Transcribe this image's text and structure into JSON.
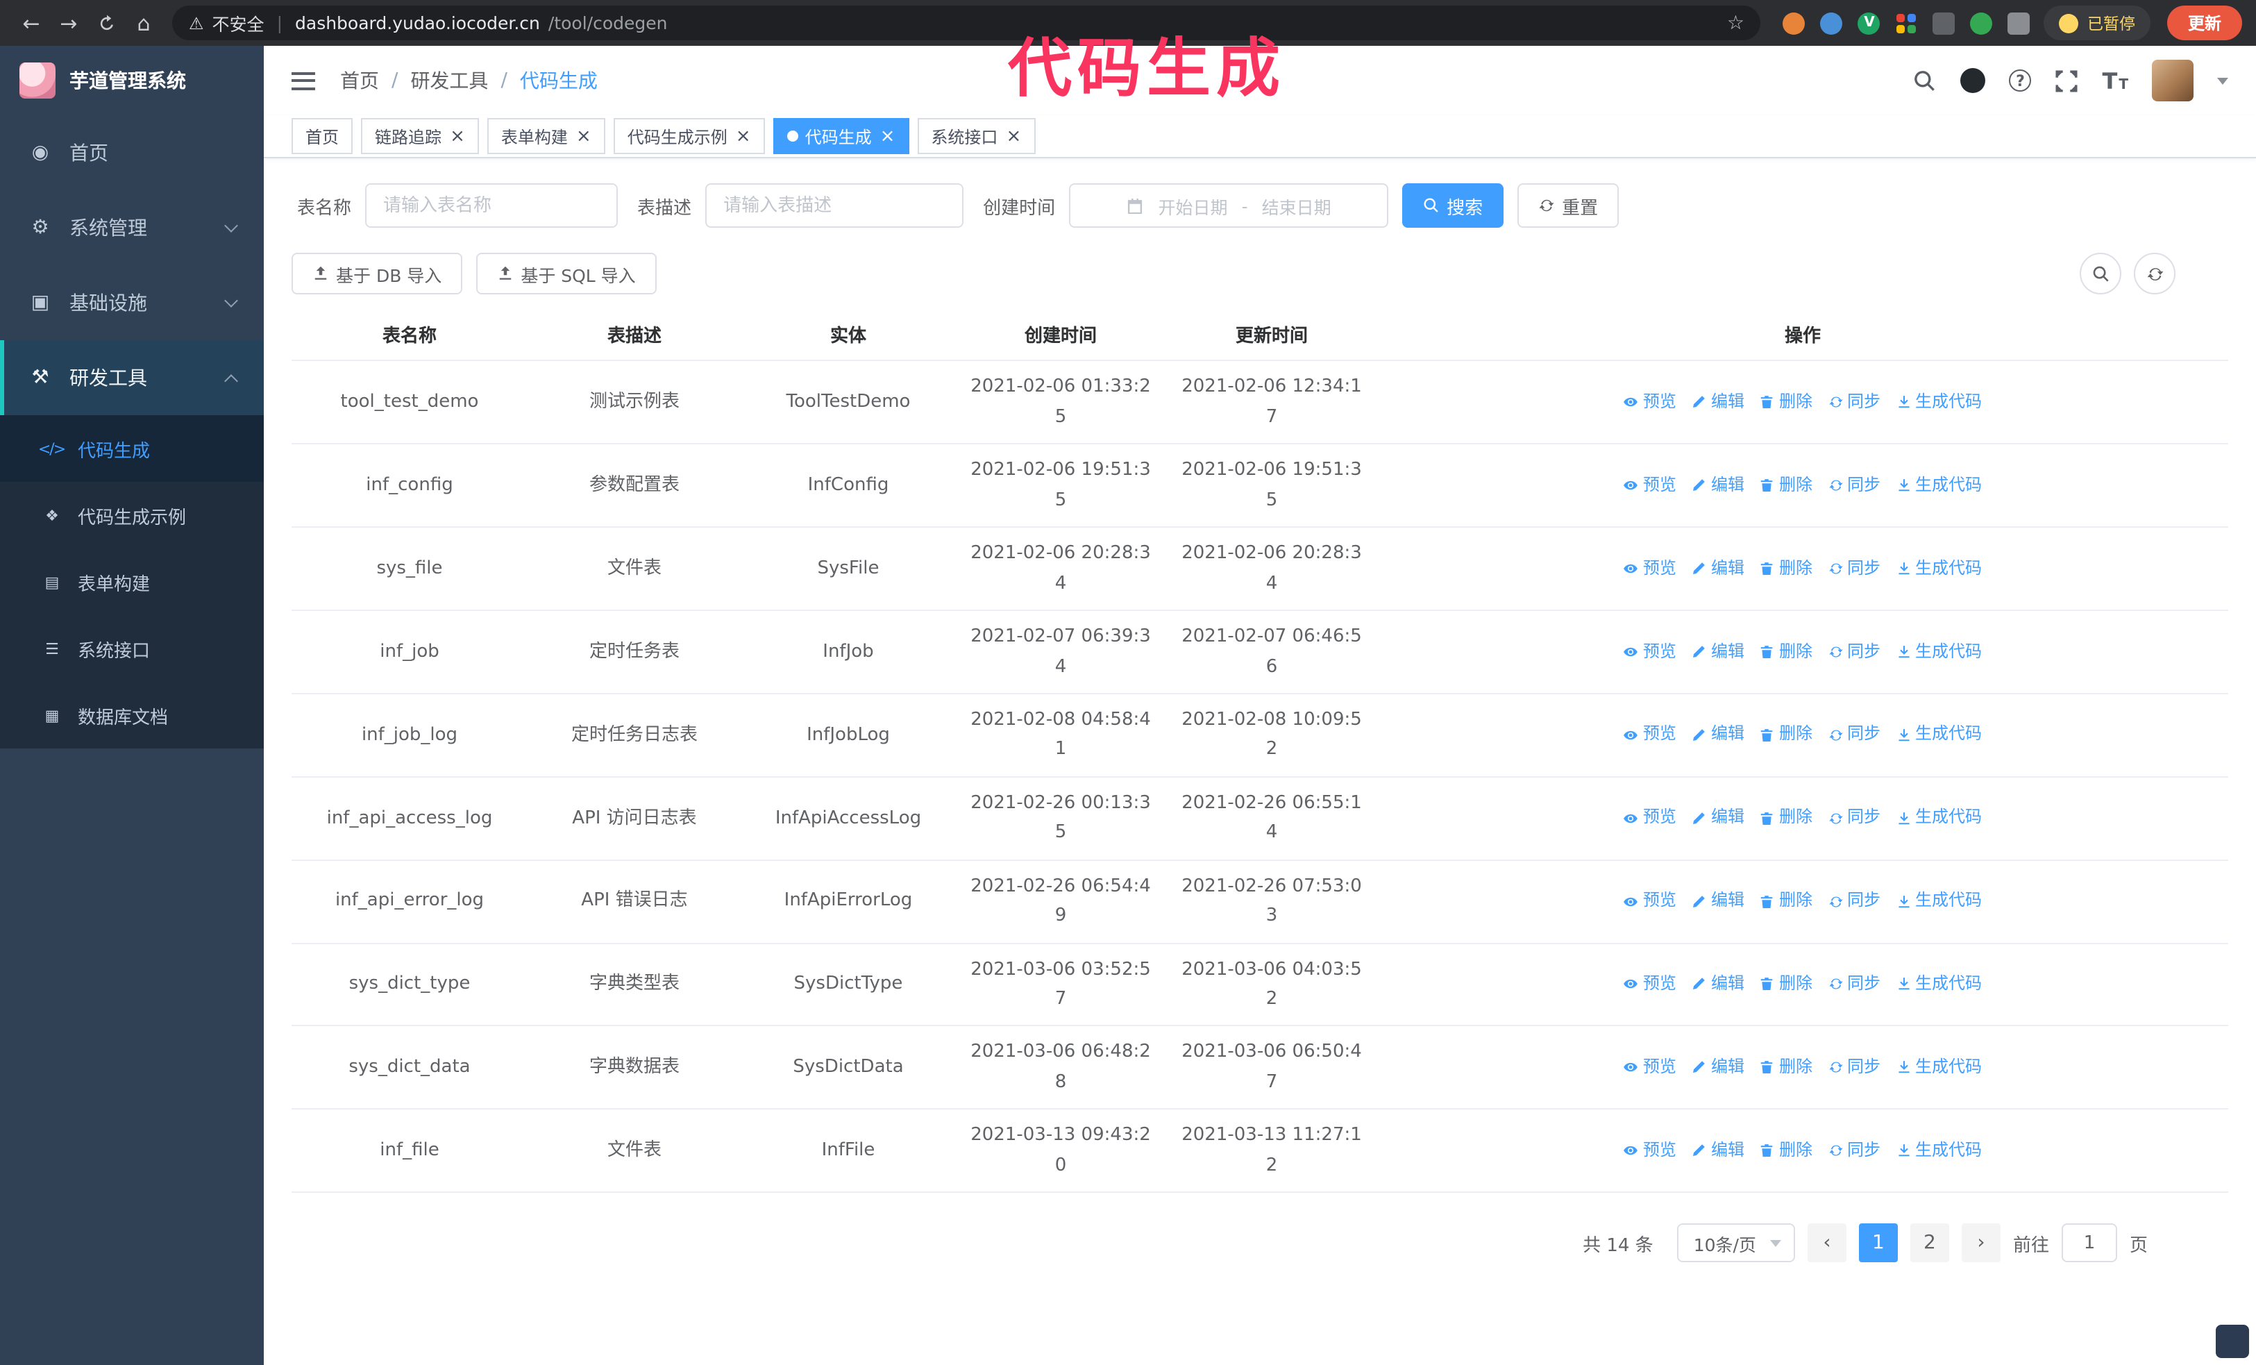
{
  "annotation": {
    "text": "代码生成"
  },
  "glyphs": {
    "back": "←",
    "forward": "→",
    "home": "⌂",
    "warning": "⚠",
    "pipe": "|",
    "star": "☆",
    "close": "×",
    "question": "?",
    "text_size": "T",
    "prev": "‹",
    "next": "›",
    "vue": "V"
  },
  "browser": {
    "security_text": "不安全",
    "url_host": "dashboard.yudao.iocoder.cn",
    "url_path": "/tool/codegen",
    "profile_badge": "已暂停",
    "update_button": "更新"
  },
  "sidebar": {
    "title": "芋道管理系统",
    "menu": [
      {
        "label": "首页",
        "icon": "◉"
      },
      {
        "label": "系统管理",
        "icon": "⚙"
      },
      {
        "label": "基础设施",
        "icon": "▣"
      },
      {
        "label": "研发工具",
        "icon": "⚒"
      }
    ],
    "submenu": [
      {
        "label": "代码生成",
        "icon": "</>"
      },
      {
        "label": "代码生成示例",
        "icon": "❖"
      },
      {
        "label": "表单构建",
        "icon": "▤"
      },
      {
        "label": "系统接口",
        "icon": "☰"
      },
      {
        "label": "数据库文档",
        "icon": "▦"
      }
    ]
  },
  "header": {
    "breadcrumb": [
      "首页",
      "研发工具",
      "代码生成"
    ],
    "breadcrumb_separator": "/"
  },
  "tabs": [
    {
      "label": "首页"
    },
    {
      "label": "链路追踪"
    },
    {
      "label": "表单构建"
    },
    {
      "label": "代码生成示例"
    },
    {
      "label": "代码生成"
    },
    {
      "label": "系统接口"
    }
  ],
  "filters": {
    "table_name_label": "表名称",
    "table_name_placeholder": "请输入表名称",
    "table_desc_label": "表描述",
    "table_desc_placeholder": "请输入表描述",
    "create_time_label": "创建时间",
    "date_start_placeholder": "开始日期",
    "date_separator": "-",
    "date_end_placeholder": "结束日期",
    "search_button": "搜索",
    "reset_button": "重置"
  },
  "toolbar": {
    "import_db": "基于 DB 导入",
    "import_sql": "基于 SQL 导入"
  },
  "table": {
    "columns": [
      "表名称",
      "表描述",
      "实体",
      "创建时间",
      "更新时间",
      "操作"
    ],
    "actions": [
      "预览",
      "编辑",
      "删除",
      "同步",
      "生成代码"
    ],
    "rows": [
      {
        "name": "tool_test_demo",
        "desc": "测试示例表",
        "entity": "ToolTestDemo",
        "created": "2021-02-06 01:33:25",
        "updated": "2021-02-06 12:34:17"
      },
      {
        "name": "inf_config",
        "desc": "参数配置表",
        "entity": "InfConfig",
        "created": "2021-02-06 19:51:35",
        "updated": "2021-02-06 19:51:35"
      },
      {
        "name": "sys_file",
        "desc": "文件表",
        "entity": "SysFile",
        "created": "2021-02-06 20:28:34",
        "updated": "2021-02-06 20:28:34"
      },
      {
        "name": "inf_job",
        "desc": "定时任务表",
        "entity": "InfJob",
        "created": "2021-02-07 06:39:34",
        "updated": "2021-02-07 06:46:56"
      },
      {
        "name": "inf_job_log",
        "desc": "定时任务日志表",
        "entity": "InfJobLog",
        "created": "2021-02-08 04:58:41",
        "updated": "2021-02-08 10:09:52"
      },
      {
        "name": "inf_api_access_log",
        "desc": "API 访问日志表",
        "entity": "InfApiAccessLog",
        "created": "2021-02-26 00:13:35",
        "updated": "2021-02-26 06:55:14"
      },
      {
        "name": "inf_api_error_log",
        "desc": "API 错误日志",
        "entity": "InfApiErrorLog",
        "created": "2021-02-26 06:54:49",
        "updated": "2021-02-26 07:53:03"
      },
      {
        "name": "sys_dict_type",
        "desc": "字典类型表",
        "entity": "SysDictType",
        "created": "2021-03-06 03:52:57",
        "updated": "2021-03-06 04:03:52"
      },
      {
        "name": "sys_dict_data",
        "desc": "字典数据表",
        "entity": "SysDictData",
        "created": "2021-03-06 06:48:28",
        "updated": "2021-03-06 06:50:47"
      },
      {
        "name": "inf_file",
        "desc": "文件表",
        "entity": "InfFile",
        "created": "2021-03-13 09:43:20",
        "updated": "2021-03-13 11:27:12"
      }
    ]
  },
  "pagination": {
    "total": "共 14 条",
    "page_size": "10条/页",
    "pages": [
      "1",
      "2"
    ],
    "goto_label": "前往",
    "goto_value": "1",
    "goto_suffix": "页"
  },
  "colors": {
    "accent": "#409eff",
    "sidebar": "#304156",
    "annotation": "#f8345f"
  }
}
